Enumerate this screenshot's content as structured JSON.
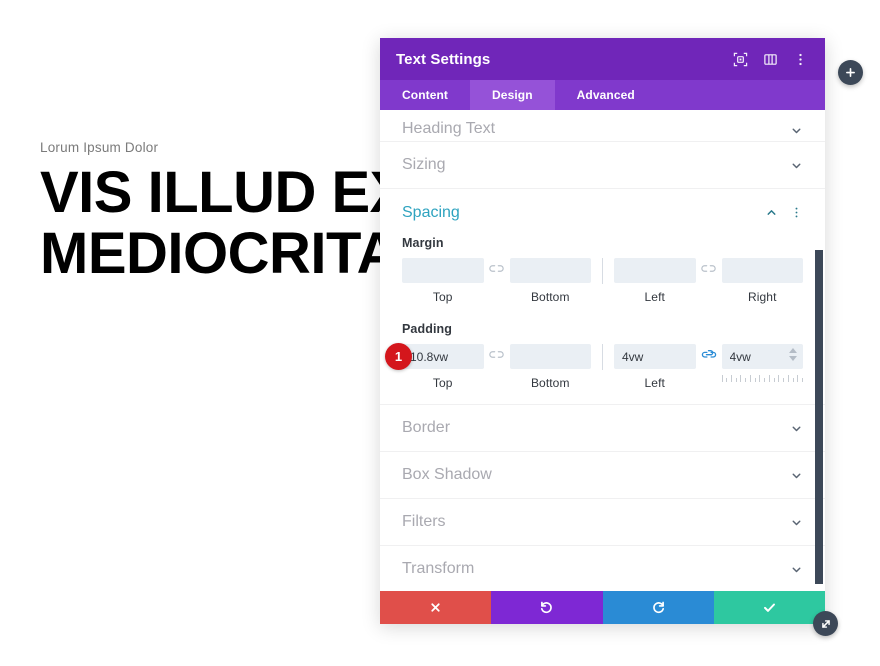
{
  "page": {
    "eyebrow": "Lorum Ipsum Dolor",
    "headline_line1": "VIS ILLUD EX",
    "headline_line2": "MEDIOCRITA"
  },
  "panel": {
    "title": "Text Settings",
    "header_icons": [
      {
        "name": "responsive-preview-icon",
        "label": "Responsive Preview"
      },
      {
        "name": "columns-layout-icon",
        "label": "Column Layout"
      },
      {
        "name": "more-options-icon",
        "label": "More Options"
      }
    ],
    "tabs": [
      {
        "label": "Content",
        "active": false
      },
      {
        "label": "Design",
        "active": true
      },
      {
        "label": "Advanced",
        "active": false
      }
    ],
    "sections_above": [
      {
        "label": "Heading Text",
        "state": "collapsed"
      },
      {
        "label": "Sizing",
        "state": "collapsed"
      }
    ],
    "open_section": {
      "label": "Spacing",
      "accent_color": "#2ea3bf",
      "groups": [
        {
          "name": "margin",
          "label": "Margin",
          "fields": [
            {
              "key": "top",
              "sublabel": "Top",
              "value": "",
              "placeholder": ""
            },
            {
              "key": "bottom",
              "sublabel": "Bottom",
              "value": "",
              "placeholder": ""
            },
            {
              "key": "left",
              "sublabel": "Left",
              "value": "",
              "placeholder": ""
            },
            {
              "key": "right",
              "sublabel": "Right",
              "value": "",
              "placeholder": ""
            }
          ],
          "link_top_bottom": "unlinked",
          "link_left_right": "unlinked"
        },
        {
          "name": "padding",
          "label": "Padding",
          "fields": [
            {
              "key": "top",
              "sublabel": "Top",
              "value": "10.8vw",
              "placeholder": ""
            },
            {
              "key": "bottom",
              "sublabel": "Bottom",
              "value": "",
              "placeholder": ""
            },
            {
              "key": "left",
              "sublabel": "Left",
              "value": "4vw",
              "placeholder": ""
            },
            {
              "key": "right",
              "sublabel": "",
              "value": "4vw",
              "placeholder": ""
            }
          ],
          "link_top_bottom": "unlinked",
          "link_left_right": "linked",
          "badge": "1"
        }
      ]
    },
    "sections_below": [
      {
        "label": "Border",
        "state": "collapsed"
      },
      {
        "label": "Box Shadow",
        "state": "collapsed"
      },
      {
        "label": "Filters",
        "state": "collapsed"
      },
      {
        "label": "Transform",
        "state": "collapsed"
      }
    ],
    "footer_buttons": [
      {
        "name": "cancel-button",
        "icon": "close-icon",
        "color": "#e04f4a"
      },
      {
        "name": "undo-button",
        "icon": "undo-icon",
        "color": "#7e28d4"
      },
      {
        "name": "redo-button",
        "icon": "redo-icon",
        "color": "#2a8bd5"
      },
      {
        "name": "save-button",
        "icon": "check-icon",
        "color": "#2ec8a0"
      }
    ],
    "header_color": "#7026b9",
    "tabbar_color": "#8039cc",
    "tab_active_color": "#9552d8"
  },
  "floating": {
    "add_button": "+",
    "resize_button": "resize-handle-icon"
  }
}
